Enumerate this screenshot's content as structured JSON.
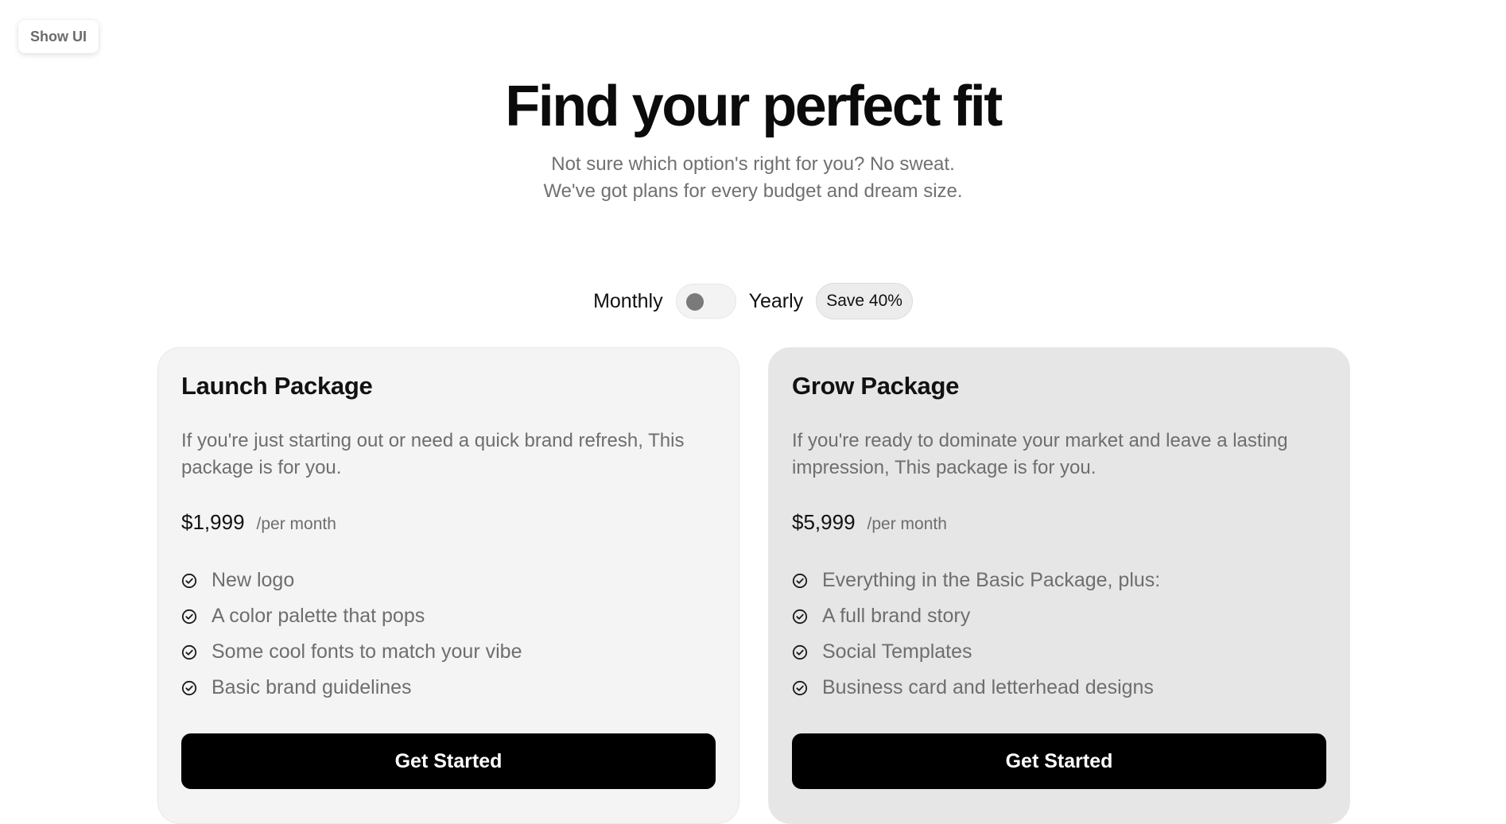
{
  "show_ui_label": "Show UI",
  "hero": {
    "title": "Find your perfect fit",
    "subtitle_line1": "Not sure which option's right for you? No sweat.",
    "subtitle_line2": "We've got plans for every budget and dream size."
  },
  "billing": {
    "monthly_label": "Monthly",
    "yearly_label": "Yearly",
    "save_badge": "Save 40%",
    "yearly_selected": false
  },
  "plans": [
    {
      "title": "Launch Package",
      "description": "If you're just starting out or need a quick brand refresh, This package is for you.",
      "price": "$1,999",
      "period": "/per month",
      "features": [
        "New logo",
        "A color palette that pops",
        "Some cool fonts to match your vibe",
        "Basic brand guidelines"
      ],
      "cta": "Get Started"
    },
    {
      "title": "Grow Package",
      "description": "If you're ready to dominate your market and leave a lasting impression, This package is for you.",
      "price": "$5,999",
      "period": "/per month",
      "features": [
        "Everything in the Basic Package, plus:",
        "A full brand story",
        "Social Templates",
        "Business card and letterhead designs"
      ],
      "cta": "Get Started"
    }
  ],
  "icons": {
    "feature_check": "check-circle-icon"
  },
  "colors": {
    "cta_background": "#000000",
    "launch_card_background": "#f4f4f4",
    "grow_card_background": "#e7e6e6",
    "muted_text": "#6e6e6e"
  }
}
